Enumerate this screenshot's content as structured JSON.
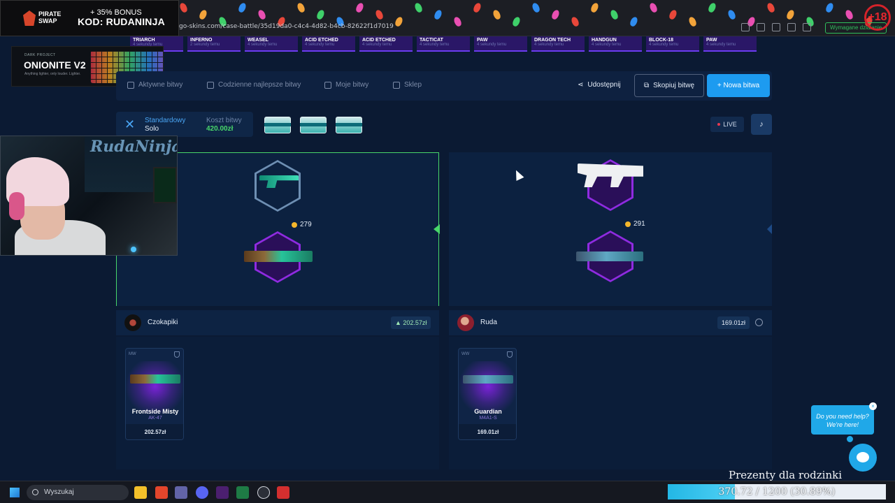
{
  "browser": {
    "url": "go-skins.com/case-battle/35d19da0-c4c4-4d82-b4cb-82622f1d7019",
    "required_label": "Wymagane działanie",
    "age_label": "+18"
  },
  "promo": {
    "brand": "PIRATE SWAP",
    "bonus": "+ 35% BONUS",
    "code": "KOD: RUDANINJA"
  },
  "keyboard_ad": {
    "brand": "DARK PROJECT",
    "title": "ONIONITE V2",
    "subtitle": "Anything lighter, only louder. Lighter."
  },
  "webcam": {
    "sign": "RudaNinja"
  },
  "drops": [
    {
      "name": "TRIARCH",
      "time": "4 sekundy temu"
    },
    {
      "name": "INFERNO",
      "time": "2 sekundy temu"
    },
    {
      "name": "WEASEL",
      "time": "4 sekundy temu"
    },
    {
      "name": "ACID ETCHED",
      "time": "4 sekundy temu"
    },
    {
      "name": "ACID ETCHED",
      "time": "4 sekundy temu"
    },
    {
      "name": "TACTICAT",
      "time": "4 sekundy temu"
    },
    {
      "name": "PAW",
      "time": "4 sekundy temu"
    },
    {
      "name": "DRAGON TECH",
      "time": "4 sekundy temu"
    },
    {
      "name": "HANDGUN",
      "time": "4 sekundy temu"
    },
    {
      "name": "BLOCK-18",
      "time": "4 sekundy temu"
    },
    {
      "name": "PAW",
      "time": "4 sekundy temu"
    }
  ],
  "tabs": {
    "active": "Aktywne bitwy",
    "daily": "Codzienne najlepsze bitwy",
    "mine": "Moje bitwy",
    "shop": "Sklep"
  },
  "actions": {
    "share": "Udostępnij",
    "copy": "Skopiuj bitwę",
    "new": "+ Nowa bitwa"
  },
  "battle": {
    "mode_name": "Standardowy",
    "mode_type": "Solo",
    "cost_label": "Koszt bitwy",
    "cost_value": "420.00zł",
    "live_label": "LIVE"
  },
  "players": [
    {
      "name": "Czokapiki",
      "score": "▲ 202.57zł",
      "spin_value": "279",
      "item": {
        "wear": "MW",
        "name": "Frontside Misty",
        "type": "AK-47",
        "price": "202.57zł"
      }
    },
    {
      "name": "Ruda",
      "score": "169.01zł",
      "spin_value": "291",
      "item": {
        "wear": "WW",
        "name": "Guardian",
        "type": "M4A1-S",
        "price": "169.01zł"
      }
    }
  ],
  "help": {
    "bubble": "Do you need help? We're here!"
  },
  "taskbar": {
    "search": "Wyszukaj"
  },
  "goal": {
    "title": "Prezenty dla rodzinki",
    "current": 370.72,
    "target": 1200,
    "progress_text": "370.72 / 1200 (30.89%)"
  },
  "colors": {
    "accent": "#1d9bf0",
    "win_green": "#48d66a",
    "rare_purple": "#7a23d8"
  }
}
